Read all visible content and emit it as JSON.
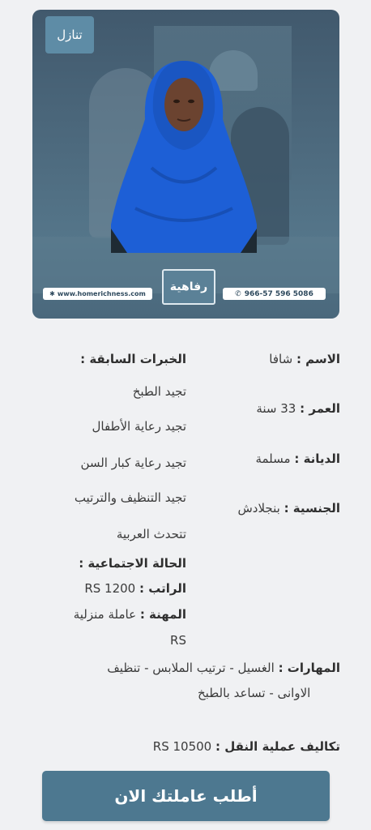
{
  "card": {
    "badge": "تنازل",
    "url": "www.homerichness.com",
    "phone": "966-57 596 5086",
    "logo_text": "رفاهية"
  },
  "profile": {
    "name": {
      "label": "الاسم :",
      "value": "شافا"
    },
    "age": {
      "label": "العمر :",
      "value": "33 سنة"
    },
    "religion": {
      "label": "الديانة :",
      "value": "مسلمة"
    },
    "nationality": {
      "label": "الجنسية :",
      "value": "بنجلادش"
    }
  },
  "experience": {
    "heading": "الخبرات السابقة :",
    "items": [
      "تجيد الطبخ",
      "تجيد رعاية الأطفال",
      "تجيد رعاية كبار السن",
      "تجيد التنظيف والترتيب",
      "تتحدث العربية"
    ]
  },
  "marital": {
    "label": "الحالة الاجتماعية :"
  },
  "salary": {
    "label": "الراتب :",
    "value": "RS 1200"
  },
  "job": {
    "label": "المهنة :",
    "value": "عاملة منزلية",
    "value2": "RS"
  },
  "skills": {
    "label": "المهارات :",
    "line1": "الغسيل - ترتيب الملابس - تنظيف",
    "line2": "الاوانى - تساعد بالطبخ"
  },
  "transfer": {
    "label": "تكاليف عملية النقل :",
    "value": "RS 10500"
  },
  "cta": {
    "label": "أطلب عاملتك الان"
  },
  "colors": {
    "accent": "#4d7890",
    "badge": "#5e8ca6",
    "headscarf": "#1d5fd6"
  }
}
